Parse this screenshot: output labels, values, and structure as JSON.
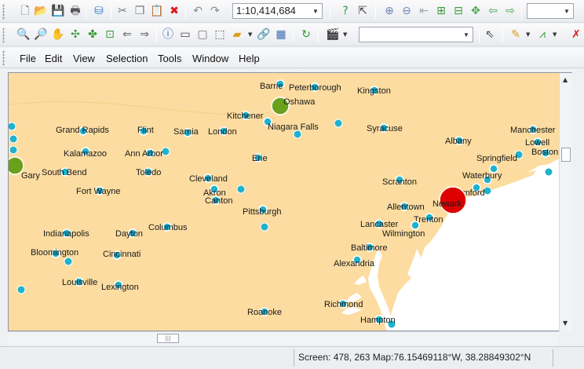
{
  "toolbar_top": {
    "scale_value": "1:10,414,684",
    "layer_value": ""
  },
  "toolbar_second": {
    "style_value": ""
  },
  "menu": {
    "items": [
      "File",
      "Edit",
      "View",
      "Selection",
      "Tools",
      "Window",
      "Help"
    ]
  },
  "map": {
    "land_color": "#fcdca0",
    "water_color": "#ffffff",
    "city_color": "#1fb2cc",
    "highlight_green": "#6aa11a",
    "highlight_red": "#dd0000",
    "cities": [
      {
        "name": "Barrie"
      },
      {
        "name": "Peterborough"
      },
      {
        "name": "Kingston"
      },
      {
        "name": "Oshawa"
      },
      {
        "name": "Kitchener"
      },
      {
        "name": "Niagara Falls"
      },
      {
        "name": "Grand Rapids"
      },
      {
        "name": "Flint"
      },
      {
        "name": "Sarnia"
      },
      {
        "name": "London"
      },
      {
        "name": "Syracuse"
      },
      {
        "name": "Manchester"
      },
      {
        "name": "Albany"
      },
      {
        "name": "Lowell"
      },
      {
        "name": "Kalamazoo"
      },
      {
        "name": "Ann Arbor"
      },
      {
        "name": "Boston"
      },
      {
        "name": "Erie"
      },
      {
        "name": "Springfield"
      },
      {
        "name": "Gary"
      },
      {
        "name": "South Bend"
      },
      {
        "name": "Toledo"
      },
      {
        "name": "Waterbury"
      },
      {
        "name": "Cleveland"
      },
      {
        "name": "Scranton"
      },
      {
        "name": "Fort Wayne"
      },
      {
        "name": "Akron"
      },
      {
        "name": "Stamford"
      },
      {
        "name": "Canton"
      },
      {
        "name": "Newark"
      },
      {
        "name": "Allentown"
      },
      {
        "name": "Pittsburgh"
      },
      {
        "name": "Trenton"
      },
      {
        "name": "Columbus"
      },
      {
        "name": "Lancaster"
      },
      {
        "name": "Indianapolis"
      },
      {
        "name": "Dayton"
      },
      {
        "name": "Wilmington"
      },
      {
        "name": "Baltimore"
      },
      {
        "name": "Bloomington"
      },
      {
        "name": "Cincinnati"
      },
      {
        "name": "Alexandria"
      },
      {
        "name": "Louisville"
      },
      {
        "name": "Lexington"
      },
      {
        "name": "Richmond"
      },
      {
        "name": "Roanoke"
      },
      {
        "name": "Hampton"
      }
    ]
  },
  "status": {
    "text": "Screen: 478, 263  Map:76.15469118°W, 38.28849302°N"
  }
}
